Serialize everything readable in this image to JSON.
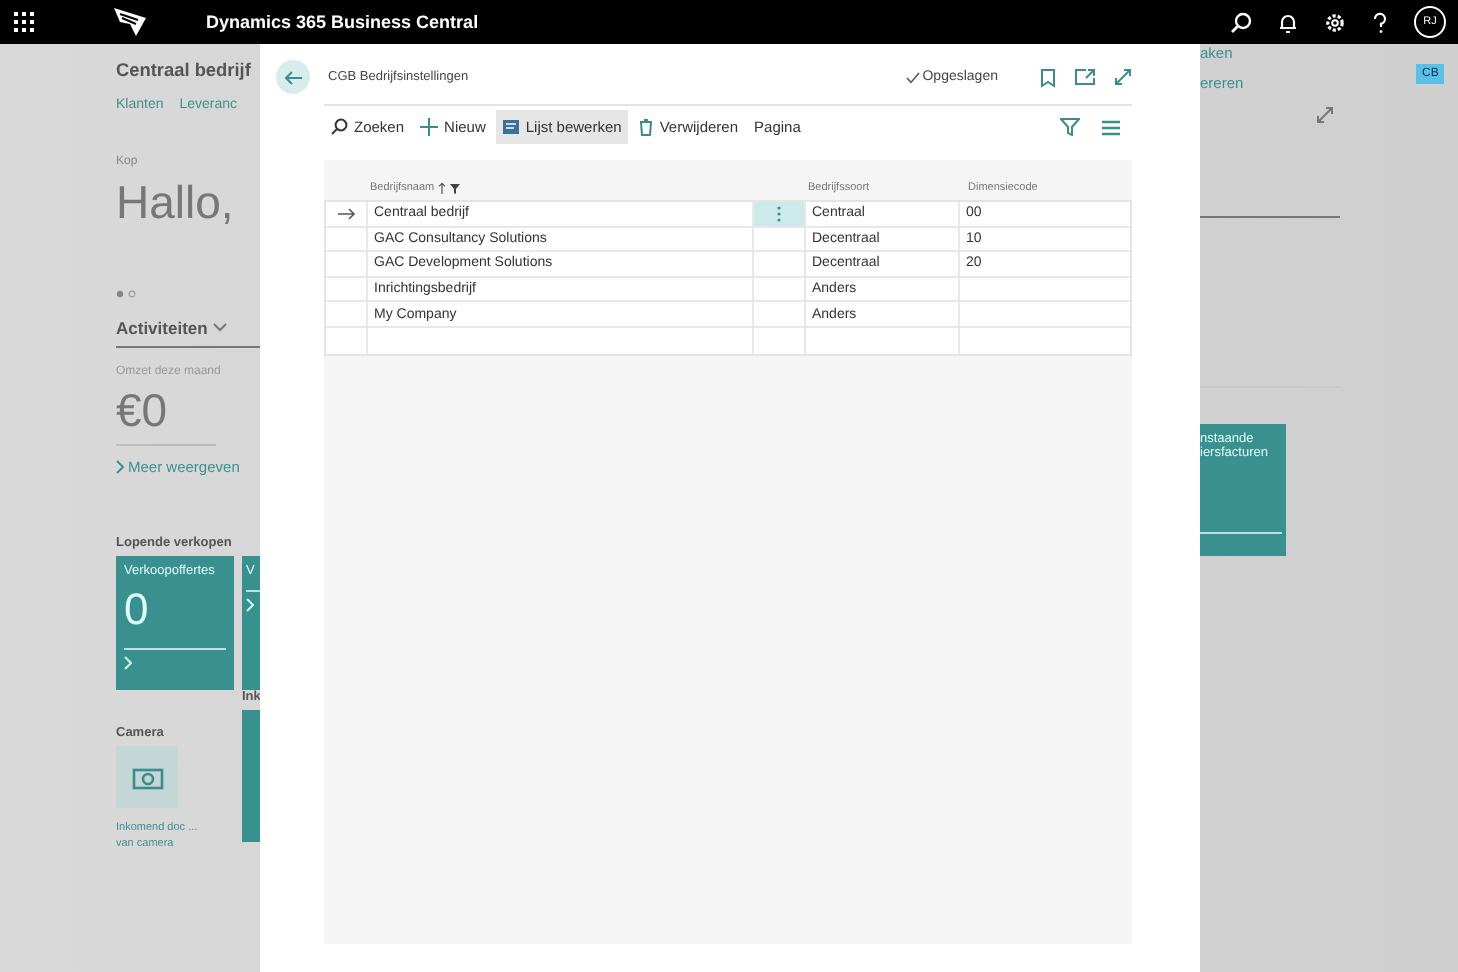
{
  "top_bar": {
    "product": "Dynamics 365 Business Central",
    "avatar": "RJ"
  },
  "background_page": {
    "company": "Centraal bedrijf",
    "links": [
      "Klanten",
      "Leveranc"
    ],
    "headline_caption": "Kop",
    "headline": "Hallo,",
    "section": "Activiteiten",
    "kpi_label": "Omzet deze maand",
    "kpi_value": "€0",
    "more_link": "Meer weergeven",
    "sales_heading": "Lopende verkopen",
    "tiles": [
      {
        "label": "Verkoopoffertes",
        "value": "0"
      },
      {
        "label": "V"
      }
    ],
    "camera_heading": "Camera",
    "camera_caption": "Inkomend doc ... van camera",
    "purchase_heading": "Ink",
    "right_links": [
      "aken",
      "ereren"
    ],
    "right_tile": "nstaande iersfacturen",
    "badge": "CB"
  },
  "dialog": {
    "title": "CGB Bedrijfsinstellingen",
    "save_state": "Opgeslagen",
    "actions": [
      {
        "label": "Zoeken",
        "selected": false
      },
      {
        "label": "Nieuw",
        "selected": false
      },
      {
        "label": "Lijst bewerken",
        "selected": true
      },
      {
        "label": "Verwijderen",
        "selected": false
      },
      {
        "label": "Pagina",
        "selected": false
      }
    ],
    "table": {
      "columns": [
        "Bedrijfsnaam",
        "Bedrijfssoort",
        "Dimensiecode"
      ],
      "rows": [
        {
          "name": "Centraal bedrijf",
          "type": "Centraal",
          "code": "00",
          "selected": true
        },
        {
          "name": "GAC Consultancy Solutions",
          "type": "Decentraal",
          "code": "10",
          "selected": false
        },
        {
          "name": "GAC Development Solutions",
          "type": "Decentraal",
          "code": "20",
          "selected": false
        },
        {
          "name": "Inrichtingsbedrijf",
          "type": "Anders",
          "code": "",
          "selected": false
        },
        {
          "name": "My Company",
          "type": "Anders",
          "code": "",
          "selected": false
        },
        {
          "name": "",
          "type": "",
          "code": "",
          "selected": false
        }
      ]
    }
  }
}
